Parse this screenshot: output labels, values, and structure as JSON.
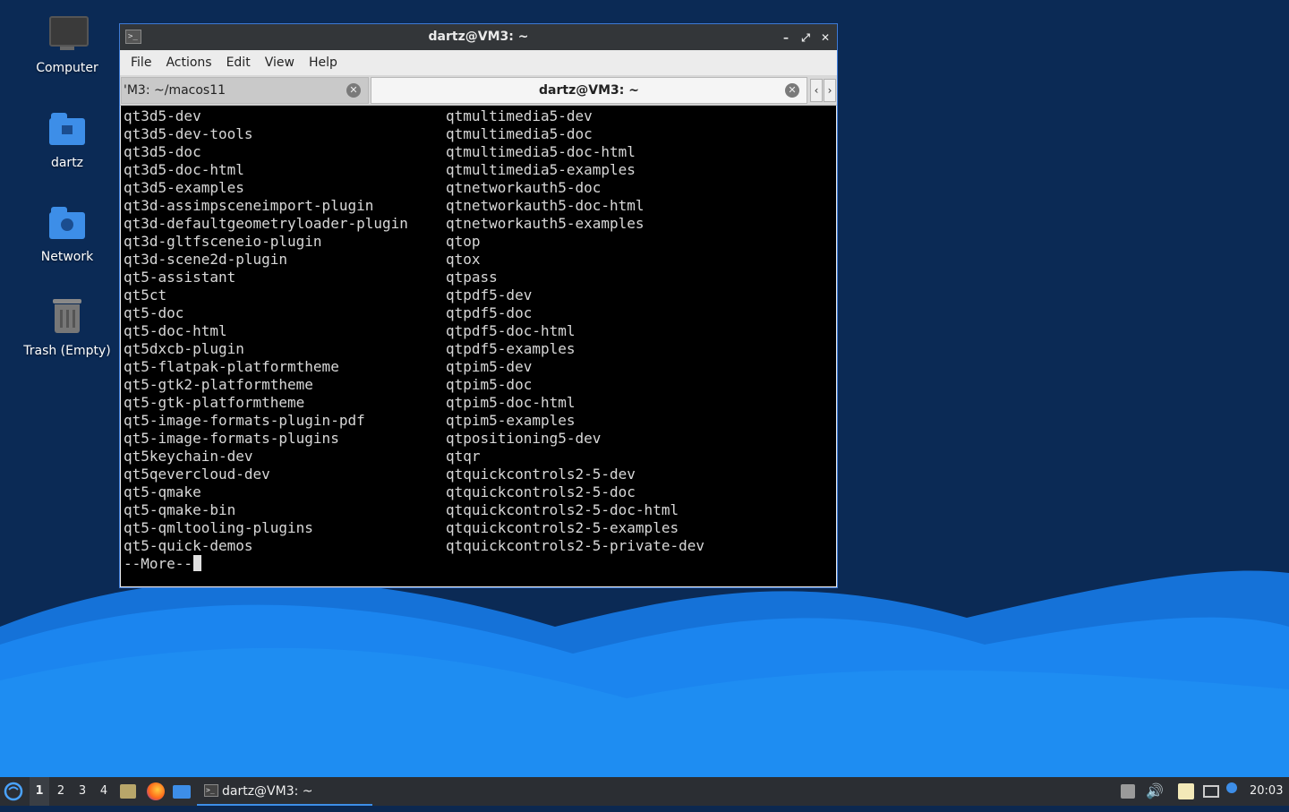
{
  "desktop": {
    "icons": [
      {
        "label": "Computer"
      },
      {
        "label": "dartz"
      },
      {
        "label": "Network"
      },
      {
        "label": "Trash (Empty)"
      }
    ]
  },
  "window": {
    "title": "dartz@VM3: ~",
    "menu": [
      "File",
      "Actions",
      "Edit",
      "View",
      "Help"
    ],
    "tabs": [
      {
        "label": "'M3: ~/macos11",
        "active": false
      },
      {
        "label": "dartz@VM3: ~",
        "active": true
      }
    ]
  },
  "terminal": {
    "col1": [
      "qt3d5-dev",
      "qt3d5-dev-tools",
      "qt3d5-doc",
      "qt3d5-doc-html",
      "qt3d5-examples",
      "qt3d-assimpsceneimport-plugin",
      "qt3d-defaultgeometryloader-plugin",
      "qt3d-gltfsceneio-plugin",
      "qt3d-scene2d-plugin",
      "qt5-assistant",
      "qt5ct",
      "qt5-doc",
      "qt5-doc-html",
      "qt5dxcb-plugin",
      "qt5-flatpak-platformtheme",
      "qt5-gtk2-platformtheme",
      "qt5-gtk-platformtheme",
      "qt5-image-formats-plugin-pdf",
      "qt5-image-formats-plugins",
      "qt5keychain-dev",
      "qt5qevercloud-dev",
      "qt5-qmake",
      "qt5-qmake-bin",
      "qt5-qmltooling-plugins",
      "qt5-quick-demos"
    ],
    "col2": [
      "qtmultimedia5-dev",
      "qtmultimedia5-doc",
      "qtmultimedia5-doc-html",
      "qtmultimedia5-examples",
      "qtnetworkauth5-doc",
      "qtnetworkauth5-doc-html",
      "qtnetworkauth5-examples",
      "qtop",
      "qtox",
      "qtpass",
      "qtpdf5-dev",
      "qtpdf5-doc",
      "qtpdf5-doc-html",
      "qtpdf5-examples",
      "qtpim5-dev",
      "qtpim5-doc",
      "qtpim5-doc-html",
      "qtpim5-examples",
      "qtpositioning5-dev",
      "qtqr",
      "qtquickcontrols2-5-dev",
      "qtquickcontrols2-5-doc",
      "qtquickcontrols2-5-doc-html",
      "qtquickcontrols2-5-examples",
      "qtquickcontrols2-5-private-dev"
    ],
    "more_prompt": "--More--"
  },
  "taskbar": {
    "workspaces": [
      "1",
      "2",
      "3",
      "4"
    ],
    "active_workspace": "1",
    "task_label": "dartz@VM3: ~",
    "clock": "20:03"
  },
  "colors": {
    "accent": "#3d8ee8",
    "desktop_bg": "#0c2850",
    "terminal_bg": "#000000"
  }
}
